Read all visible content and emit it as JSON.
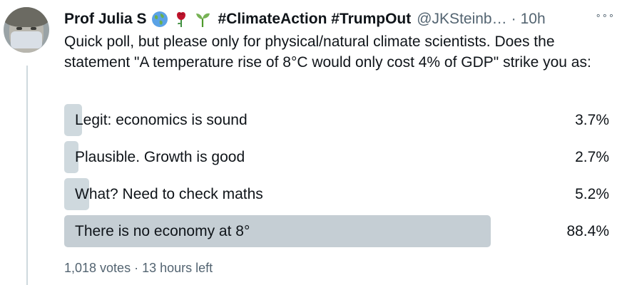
{
  "author": {
    "name": "Prof Julia S",
    "hashtags": "#ClimateAction #TrumpOut",
    "handle": "@JKSteinb…",
    "separator": "·",
    "time": "10h",
    "emojis": [
      "globe-icon",
      "rose-icon",
      "seedling-icon"
    ]
  },
  "tweet": {
    "text": "Quick poll, but please only for physical/natural climate scientists. Does the statement \"A temperature rise of 8°C would only cost 4% of GDP\" strike you as:"
  },
  "poll": {
    "options": [
      {
        "label": "Legit: economics is sound",
        "percent": "3.7%",
        "value": 0.037
      },
      {
        "label": "Plausible. Growth is good",
        "percent": "2.7%",
        "value": 0.027
      },
      {
        "label": "What? Need to check maths",
        "percent": "5.2%",
        "value": 0.052
      },
      {
        "label": "There is no economy at 8°",
        "percent": "88.4%",
        "value": 0.884
      }
    ],
    "votes": "1,018 votes",
    "separator": "·",
    "time_left": "13 hours left"
  },
  "more_label": "∘∘∘"
}
